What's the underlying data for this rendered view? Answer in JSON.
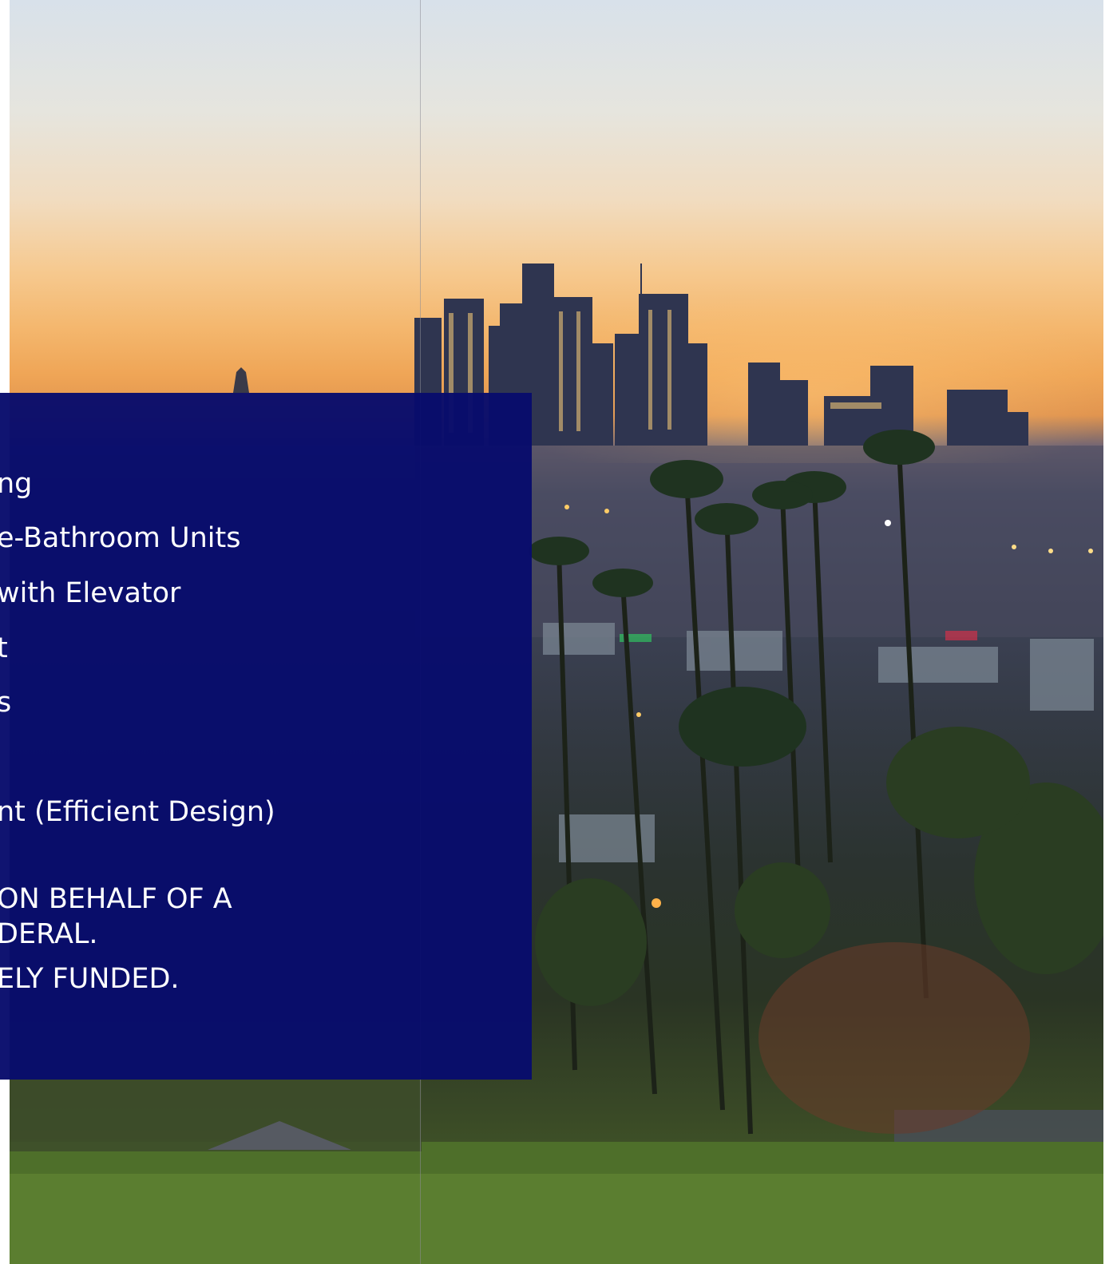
{
  "panel": {
    "lines": [
      "ng",
      "e-Bathroom Units",
      "with Elevator",
      "t",
      "s",
      "nt (Efficient Design)",
      "ON BEHALF OF A",
      "DERAL.",
      "ELY FUNDED."
    ],
    "background_color": "#080c6c"
  },
  "background_photo": {
    "description_icon": "city-skyline-sunset-photo-icon"
  }
}
